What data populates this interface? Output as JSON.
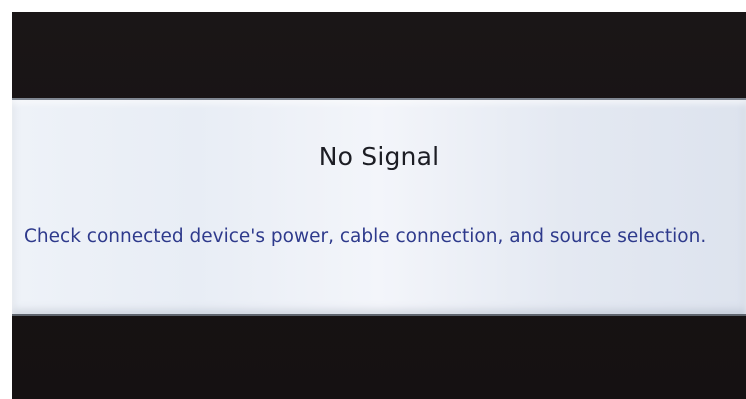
{
  "dialog": {
    "title": "No Signal",
    "message": "Check connected device's power, cable connection, and source selection."
  },
  "colors": {
    "screen_background": "#181314",
    "dialog_background": "#eef2f8",
    "title_text": "#1c1d24",
    "message_text": "#2e3a8c"
  }
}
